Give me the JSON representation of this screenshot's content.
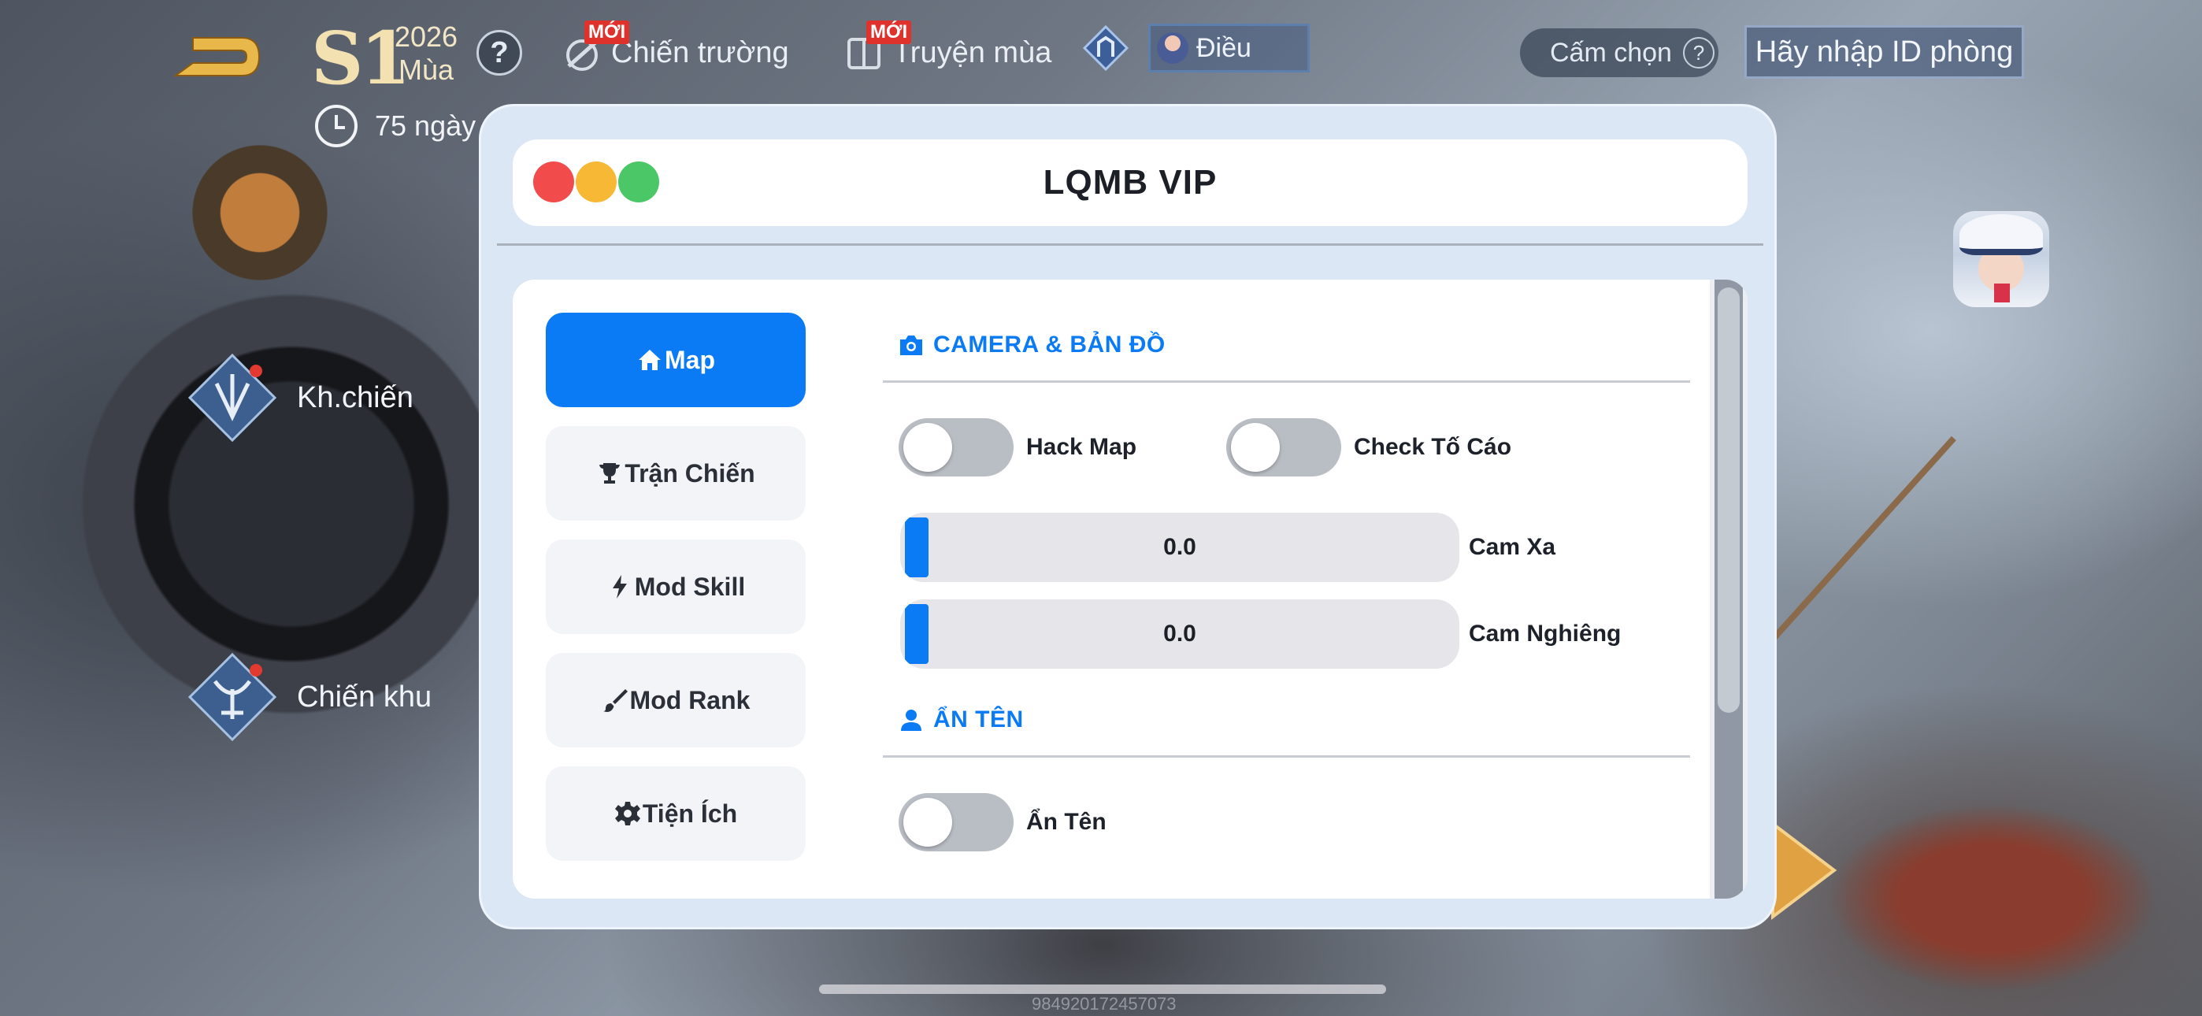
{
  "hud": {
    "season_label": "S1",
    "season_year": "2026",
    "season_word": "Mùa",
    "season_days": "75 ngày",
    "help_glyph": "?",
    "tab_battlefield": "Chiến trường",
    "tab_story": "Truyện mùa",
    "new_badge": "MỚI",
    "dieu_label": "Điều",
    "filter_label": "Cấm chọn",
    "room_id_placeholder": "Hãy nhập ID phòng",
    "mode_kh": "Kh.chiến",
    "mode_chien_khu": "Chiến khu",
    "device_id": "984920172457073"
  },
  "modal": {
    "title": "LQMB VIP",
    "nav": [
      {
        "label": "Map",
        "icon": "home-icon",
        "active": true
      },
      {
        "label": "Trận Chiến",
        "icon": "trophy-icon",
        "active": false
      },
      {
        "label": "Mod Skill",
        "icon": "bolt-icon",
        "active": false
      },
      {
        "label": "Mod Rank",
        "icon": "brush-icon",
        "active": false
      },
      {
        "label": "Tiện Ích",
        "icon": "gear-icon",
        "active": false
      }
    ],
    "sections": {
      "camera": {
        "title": "CAMERA & BẢN ĐỒ",
        "icon": "camera-icon",
        "toggles": [
          {
            "label": "Hack Map",
            "on": false
          },
          {
            "label": "Check Tố Cáo",
            "on": false
          }
        ],
        "sliders": [
          {
            "label": "Cam Xa",
            "value": "0.0"
          },
          {
            "label": "Cam Nghiêng",
            "value": "0.0"
          }
        ]
      },
      "hide_name": {
        "title": "ẨN TÊN",
        "icon": "user-icon",
        "toggles": [
          {
            "label": "Ẩn Tên",
            "on": false
          }
        ]
      }
    }
  },
  "colors": {
    "accent": "#0a7bf5",
    "traffic_red": "#f14b4b",
    "traffic_yellow": "#f7b935",
    "traffic_green": "#4cc768",
    "modal_bg": "#dbe7f4"
  }
}
